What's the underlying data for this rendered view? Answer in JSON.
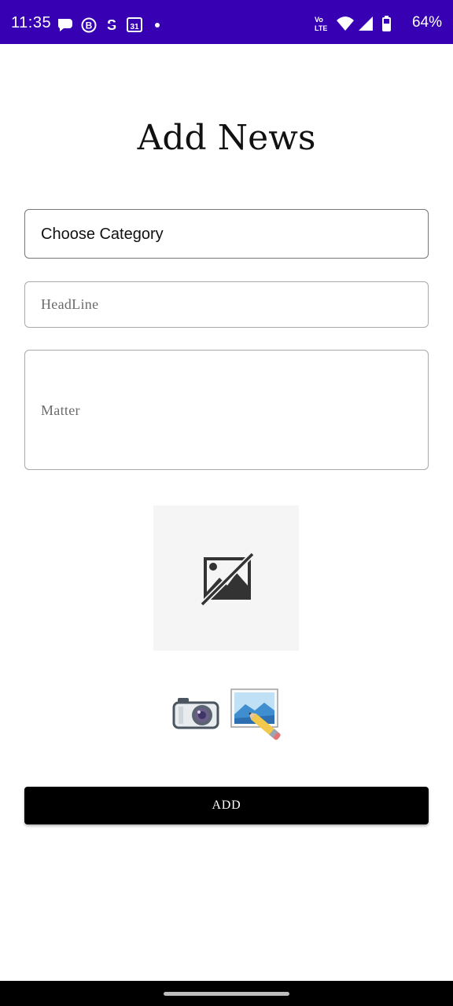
{
  "status_bar": {
    "time": "11:35",
    "battery": "64%",
    "icons_left": [
      "chat-bubble-icon",
      "b-circle-icon",
      "s-icon",
      "calendar-31-icon",
      "dot-icon"
    ],
    "icons_right": [
      "volte-icon",
      "wifi-icon",
      "signal-icon",
      "battery-icon"
    ]
  },
  "page": {
    "title": "Add News"
  },
  "form": {
    "category_label": "Choose Category",
    "headline_placeholder": "HeadLine",
    "matter_placeholder": "Matter"
  },
  "media": {
    "preview_icon": "broken-image-icon",
    "camera_icon": "camera-icon",
    "gallery_icon": "image-edit-icon"
  },
  "actions": {
    "add_label": "ADD"
  }
}
